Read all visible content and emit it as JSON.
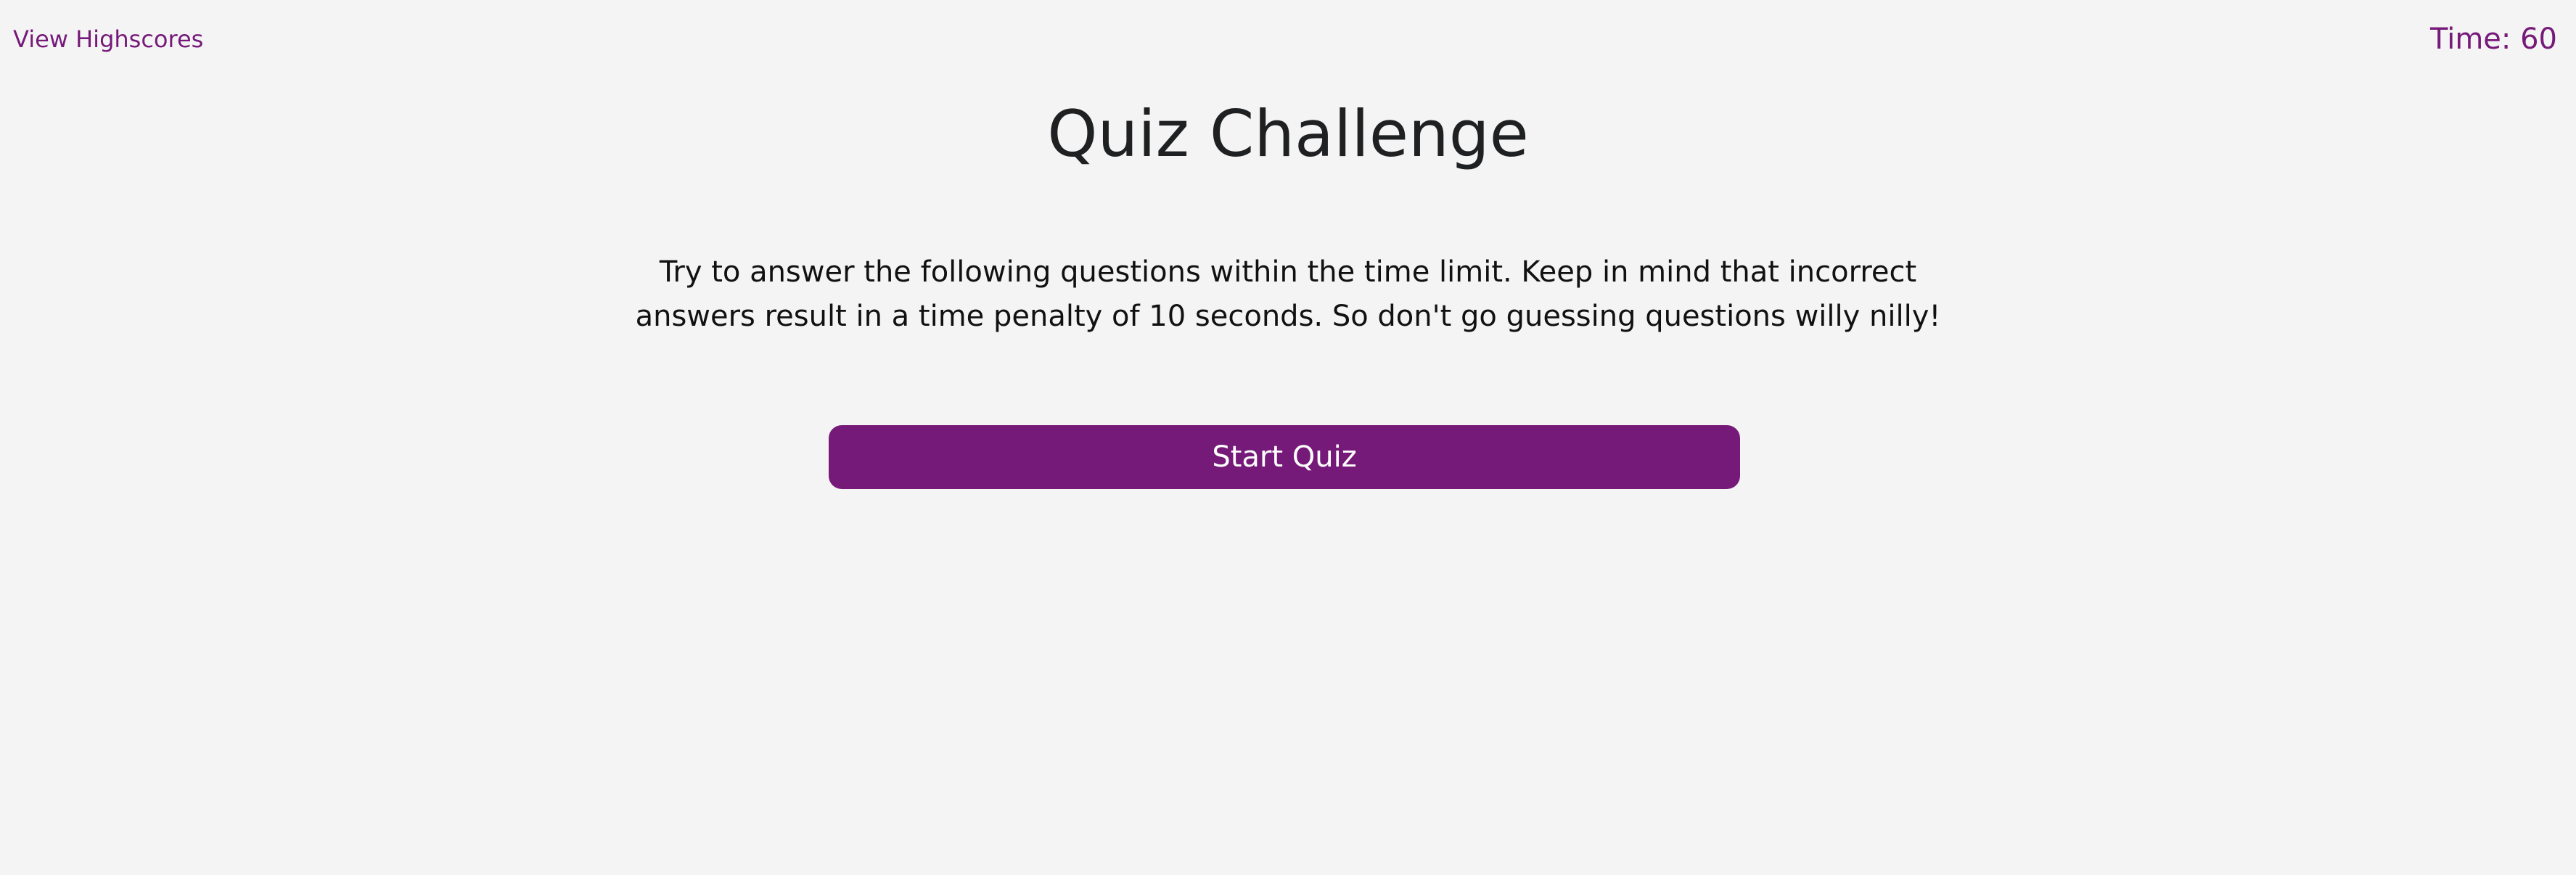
{
  "header": {
    "highscores_label": "View Highscores",
    "timer_label": "Time: 60"
  },
  "main": {
    "title": "Quiz Challenge",
    "intro": "Try to answer the following questions within the time limit. Keep in mind that incorrect answers result in a time penalty of 10 seconds. So don't go guessing questions willy nilly!",
    "start_button_label": "Start Quiz"
  },
  "colors": {
    "accent": "#761a7a",
    "background": "#f4f4f4",
    "text": "#1f1f1f"
  }
}
